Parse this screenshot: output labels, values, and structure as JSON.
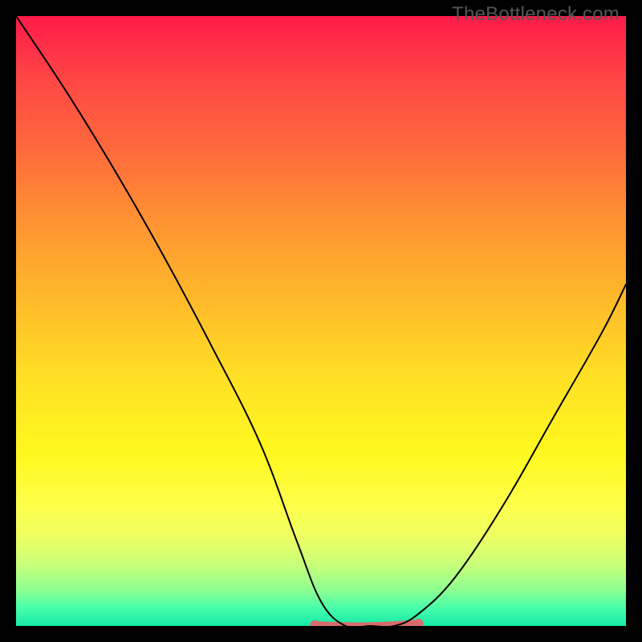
{
  "watermark": "TheBottleneck.com",
  "chart_data": {
    "type": "line",
    "title": "",
    "xlabel": "",
    "ylabel": "",
    "xlim": [
      0,
      100
    ],
    "ylim": [
      0,
      100
    ],
    "series": [
      {
        "name": "bottleneck-curve",
        "x": [
          0,
          8,
          16,
          24,
          32,
          40,
          46,
          50,
          54,
          58,
          62,
          66,
          72,
          80,
          88,
          96,
          100
        ],
        "values": [
          100,
          88,
          75,
          61,
          46,
          30,
          14,
          4,
          0,
          0,
          0,
          2,
          8,
          20,
          34,
          48,
          56
        ]
      }
    ],
    "low_band": {
      "note": "highlighted near-zero bottleneck region",
      "x_start": 49,
      "x_end": 66,
      "y": 0
    },
    "background_gradient": {
      "top": "#ff1a49",
      "mid": "#ffe224",
      "bottom": "#14e8a8"
    }
  }
}
